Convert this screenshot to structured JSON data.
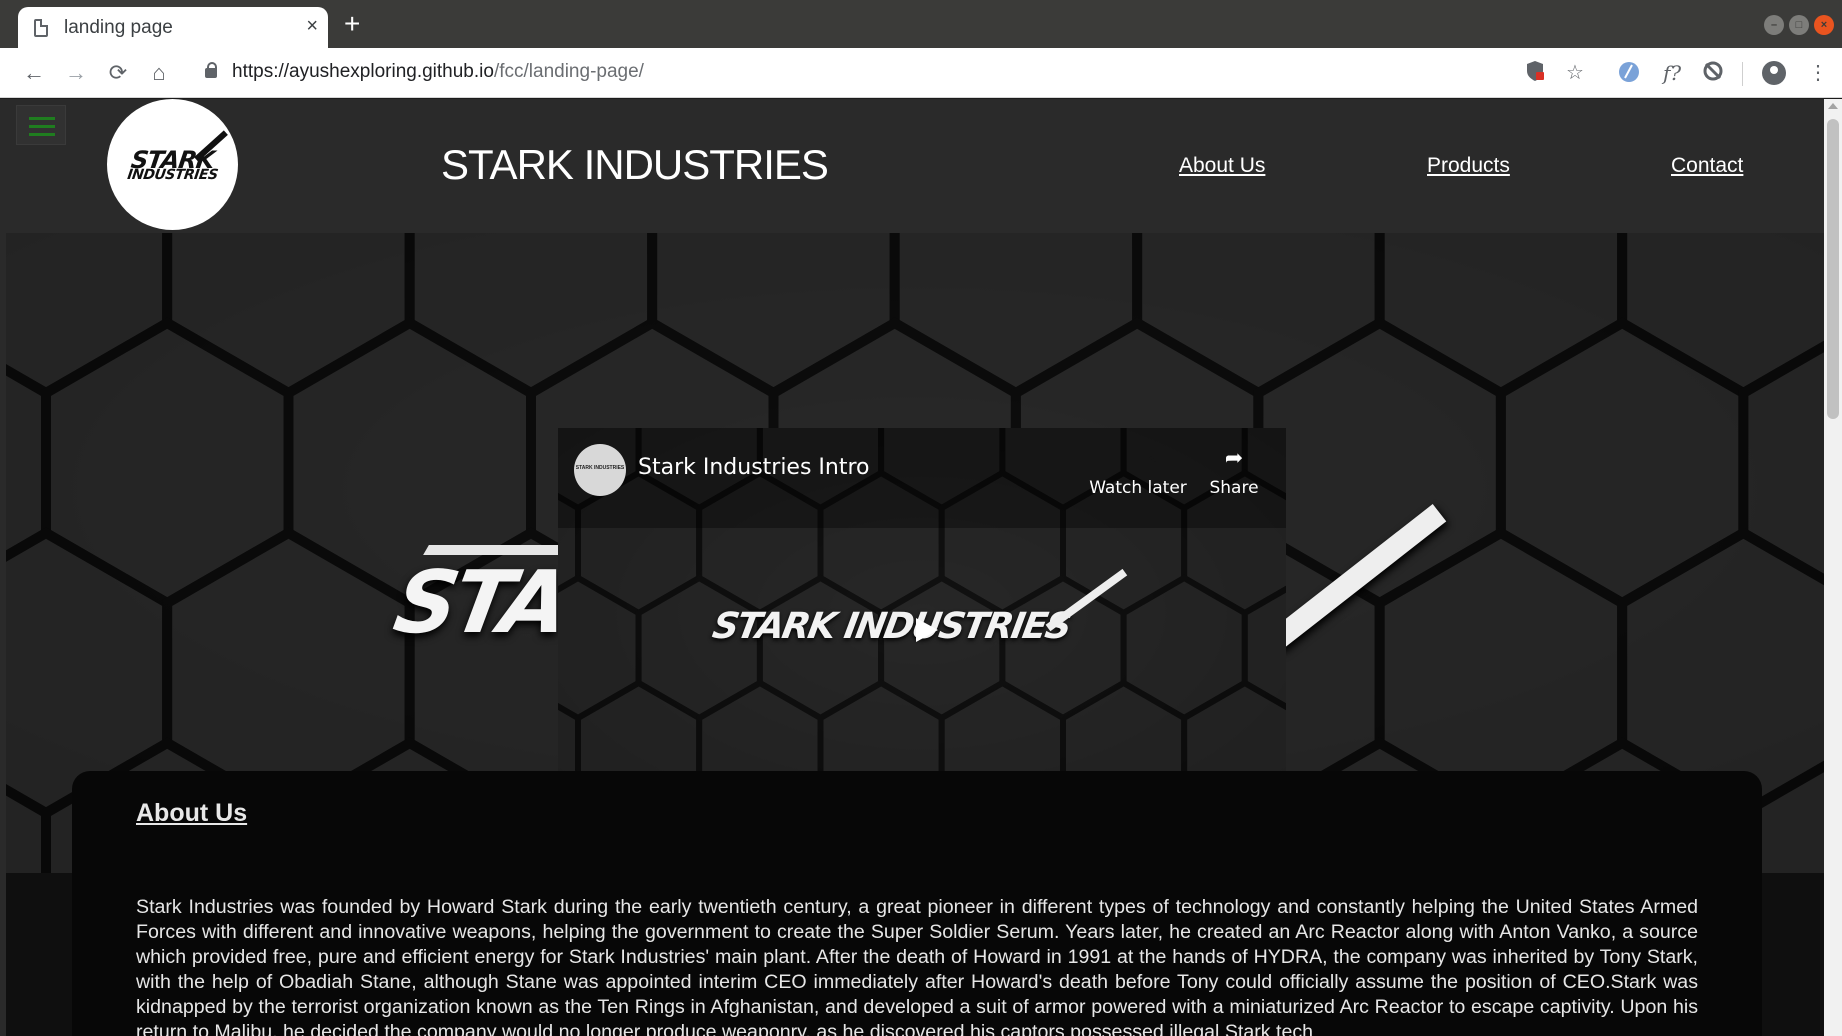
{
  "browser": {
    "tab_title": "landing page",
    "tab_close": "×",
    "new_tab": "+",
    "url_host": "https://ayushexploring.github.io",
    "url_path": "/fcc/landing-page/",
    "nav": {
      "back": "←",
      "forward": "→",
      "reload": "⟳",
      "home": "⌂"
    },
    "extensions": {
      "bookmark": "☆",
      "formula": "f?",
      "menu": "⋮"
    }
  },
  "site": {
    "logo_line1": "STARK",
    "logo_line2": "INDUSTRIES",
    "title": "STARK INDUSTRIES",
    "nav": [
      {
        "label": "About Us"
      },
      {
        "label": "Products"
      },
      {
        "label": "Contact"
      }
    ]
  },
  "hero": {
    "video": {
      "title": "Stark Industries Intro",
      "channel_label": "STARK INDUSTRIES",
      "watch_later": "Watch later",
      "share": "Share",
      "thumbnail_text": "STARK INDUSTRIES"
    }
  },
  "about": {
    "heading": "About Us",
    "text": "Stark Industries was founded by Howard Stark during the early twentieth century, a great pioneer in different types of technology and constantly helping the United States Armed Forces with different and innovative weapons, helping the government to create the Super Soldier Serum. Years later, he created an Arc Reactor along with Anton Vanko, a source which provided free, pure and efficient energy for Stark Industries' main plant. After the death of Howard in 1991 at the hands of HYDRA, the company was inherited by Tony Stark, with the help of Obadiah Stane, although Stane was appointed interim CEO immediately after Howard's death before Tony could officially assume the position of CEO.Stark was kidnapped by the terrorist organization known as the Ten Rings in Afghanistan, and developed a suit of armor powered with a miniaturized Arc Reactor to escape captivity. Upon his return to Malibu, he decided the company would no longer produce weaponry, as he discovered his captors possessed illegal Stark tech"
  },
  "colors": {
    "header_bg": "#2a2a2a",
    "menu_accent": "#1f7d1f",
    "close_button": "#e9541f"
  }
}
